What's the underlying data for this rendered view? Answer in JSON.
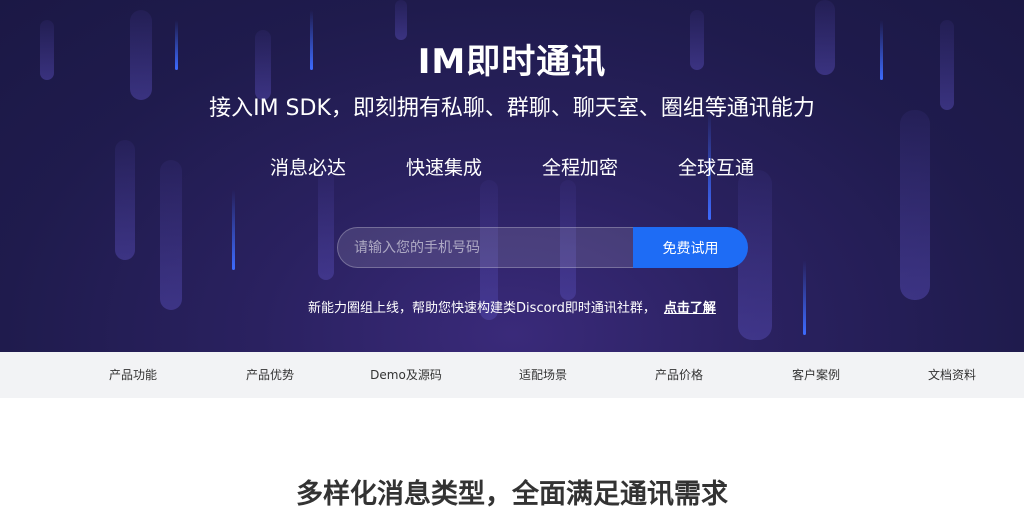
{
  "hero": {
    "title": "IM即时通讯",
    "subtitle": "接入IM SDK，即刻拥有私聊、群聊、聊天室、圈组等通讯能力",
    "features": [
      "消息必达",
      "快速集成",
      "全程加密",
      "全球互通"
    ]
  },
  "signup": {
    "placeholder": "请输入您的手机号码",
    "button_label": "免费试用"
  },
  "notice": {
    "text": "新能力圈组上线，帮助您快速构建类Discord即时通讯社群，",
    "link_label": "点击了解"
  },
  "nav": {
    "items": [
      "产品功能",
      "产品优势",
      "Demo及源码",
      "适配场景",
      "产品价格",
      "客户案例",
      "文档资料"
    ]
  },
  "section": {
    "title": "多样化消息类型，全面满足通讯需求"
  },
  "colors": {
    "hero_background": "#1f1b4d",
    "accent": "#1e6cf5",
    "nav_background": "#f2f3f5"
  }
}
